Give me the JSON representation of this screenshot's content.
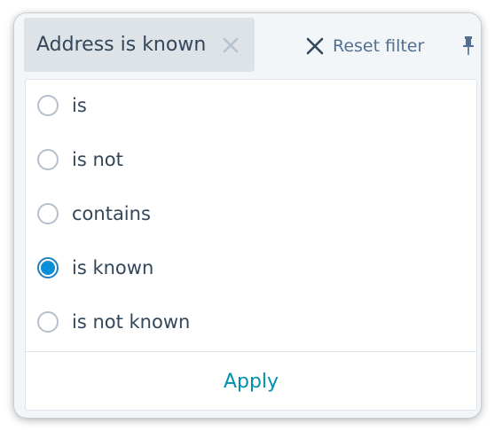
{
  "filter_chip": {
    "field": "Address",
    "operator": "is known",
    "close_icon": "close-icon"
  },
  "reset_filter": {
    "label": "Reset filter",
    "icon": "close-icon"
  },
  "pin_icon": "pin-icon",
  "options": [
    {
      "label": "is",
      "checked": false
    },
    {
      "label": "is not",
      "checked": false
    },
    {
      "label": "contains",
      "checked": false
    },
    {
      "label": "is known",
      "checked": true
    },
    {
      "label": "is not known",
      "checked": false
    }
  ],
  "apply_label": "Apply",
  "colors": {
    "accent": "#0091ae",
    "text": "#33475b",
    "muted": "#516f90",
    "chip_bg": "#dde3e6"
  }
}
